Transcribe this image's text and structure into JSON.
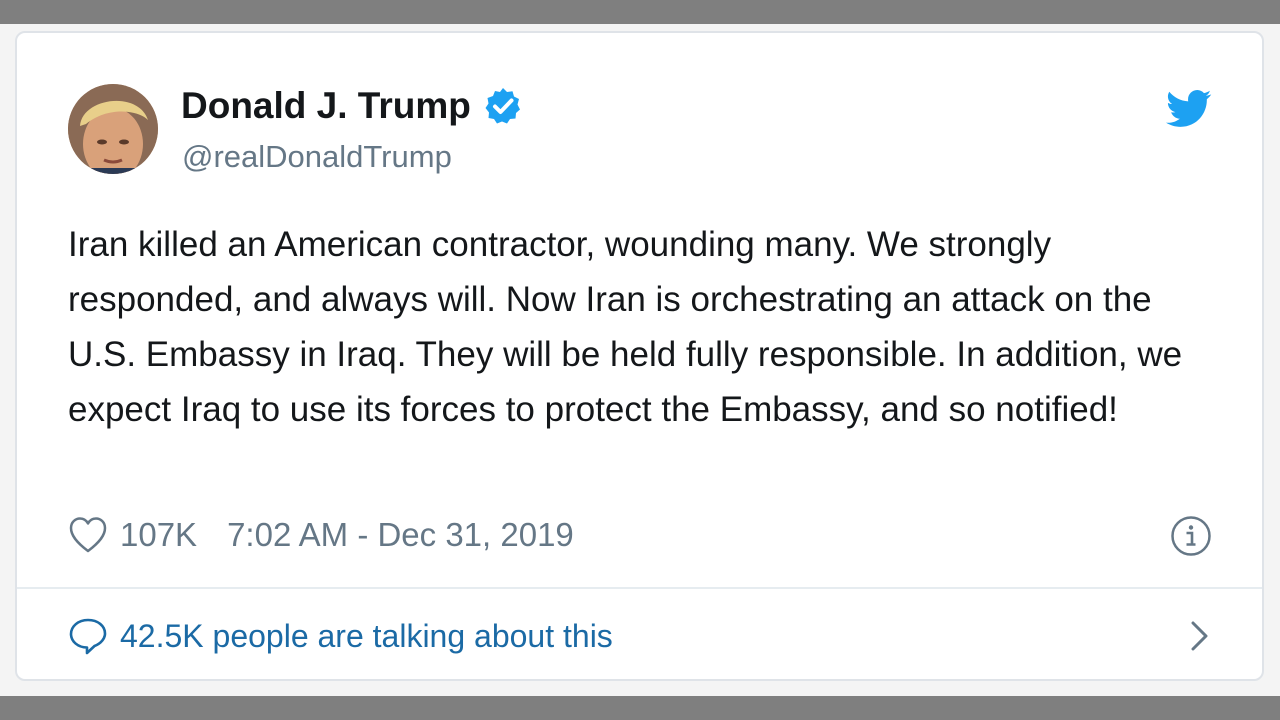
{
  "tweet": {
    "display_name": "Donald J. Trump",
    "handle": "@realDonaldTrump",
    "verified": true,
    "text": "Iran killed an American contractor, wounding many. We strongly responded, and always will. Now Iran is orchestrating an attack on the U.S. Embassy in Iraq. They will be held fully responsible. In addition, we expect Iraq to use its forces to protect the Embassy, and so notified!",
    "likes": "107K",
    "timestamp": "7:02 AM - Dec 31, 2019",
    "talking_about": "42.5K people are talking about this"
  },
  "icons": {
    "verified": "verified-badge-icon",
    "brand": "twitter-bird-icon",
    "like": "heart-icon",
    "info": "info-icon",
    "reply": "speech-bubble-icon",
    "more": "chevron-right-icon"
  },
  "colors": {
    "brand_blue": "#1da1f2",
    "link_blue": "#1b6aa5",
    "text_primary": "#14171a",
    "text_secondary": "#657786"
  }
}
